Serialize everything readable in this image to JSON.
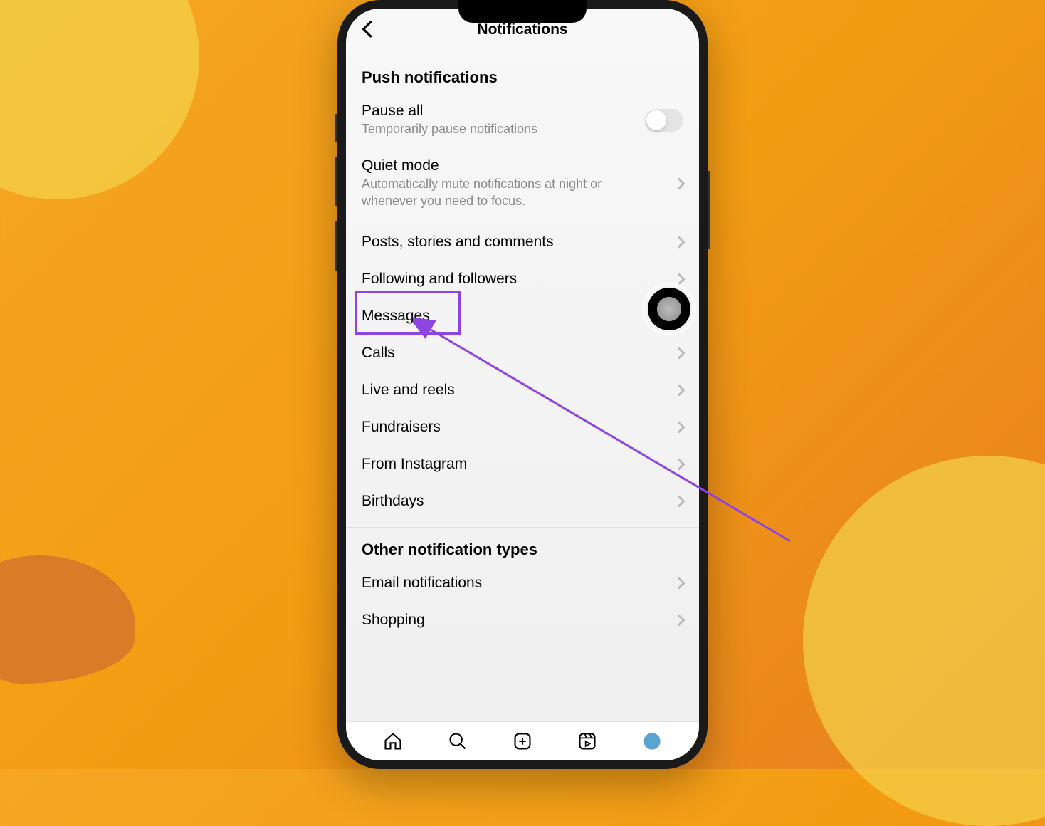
{
  "header": {
    "title": "Notifications"
  },
  "sections": {
    "push": {
      "title": "Push notifications",
      "pauseAll": {
        "label": "Pause all",
        "sublabel": "Temporarily pause notifications"
      },
      "quietMode": {
        "label": "Quiet mode",
        "sublabel": "Automatically mute notifications at night or whenever you need to focus."
      },
      "items": [
        {
          "label": "Posts, stories and comments"
        },
        {
          "label": "Following and followers"
        },
        {
          "label": "Messages"
        },
        {
          "label": "Calls"
        },
        {
          "label": "Live and reels"
        },
        {
          "label": "Fundraisers"
        },
        {
          "label": "From Instagram"
        },
        {
          "label": "Birthdays"
        }
      ]
    },
    "other": {
      "title": "Other notification types",
      "items": [
        {
          "label": "Email notifications"
        },
        {
          "label": "Shopping"
        }
      ]
    }
  },
  "annotation": {
    "highlightedItem": "Messages",
    "highlightColor": "#8e44e0"
  }
}
